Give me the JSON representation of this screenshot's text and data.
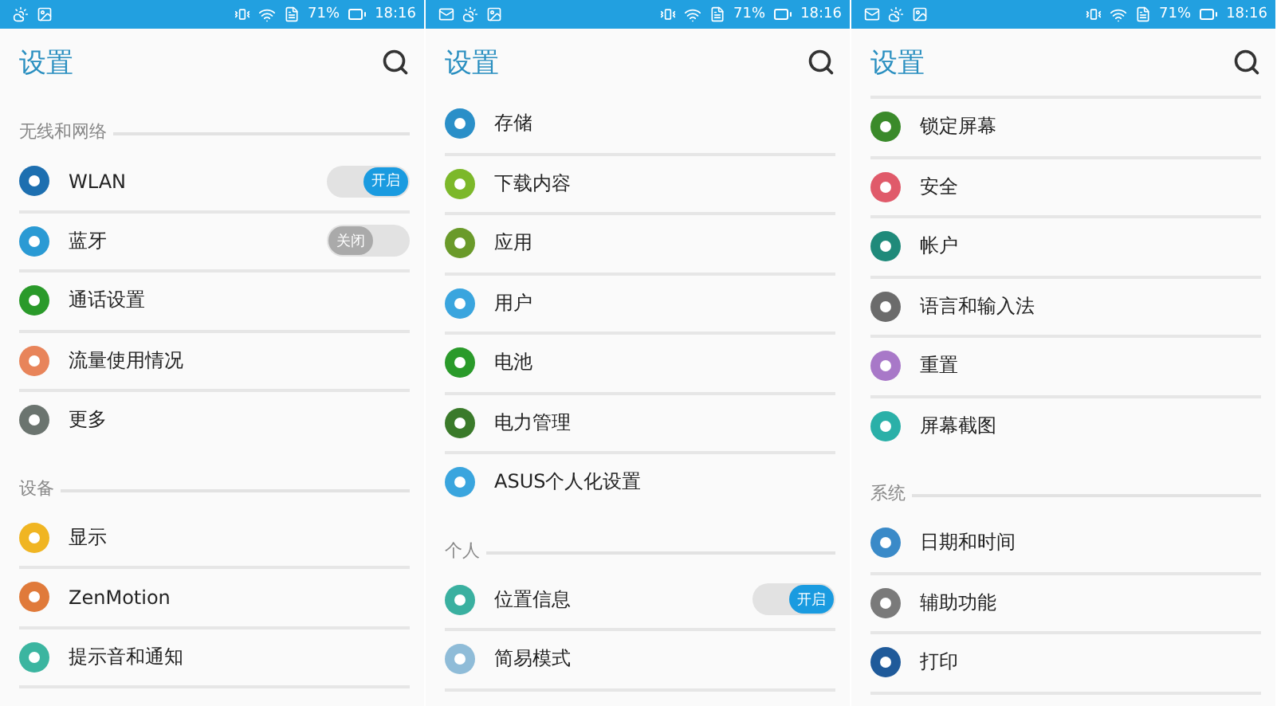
{
  "panels": [
    {
      "status_bar": {
        "notifications": [
          {
            "kind": "weather"
          },
          {
            "kind": "image"
          }
        ],
        "battery": "71%",
        "time": "18:16"
      },
      "title": "设置",
      "items": [
        {
          "kind": "section",
          "label": "无线和网络"
        },
        {
          "kind": "item",
          "label": "WLAN",
          "color": "#1d6fb0",
          "toggle": {
            "on": true,
            "label": "开启"
          }
        },
        {
          "kind": "item",
          "label": "蓝牙",
          "color": "#2a9ad4",
          "toggle": {
            "on": false,
            "label": "关闭"
          }
        },
        {
          "kind": "item",
          "label": "通话设置",
          "color": "#2a9a2a"
        },
        {
          "kind": "item",
          "label": "流量使用情况",
          "color": "#e8845a"
        },
        {
          "kind": "item",
          "label": "更多",
          "color": "#6b746f"
        },
        {
          "kind": "section",
          "label": "设备"
        },
        {
          "kind": "item",
          "label": "显示",
          "color": "#f0b522"
        },
        {
          "kind": "item",
          "label": "ZenMotion",
          "color": "#e07a3a"
        },
        {
          "kind": "item",
          "label": "提示音和通知",
          "color": "#3bb5a0"
        }
      ]
    },
    {
      "status_bar": {
        "notifications": [
          {
            "kind": "message"
          },
          {
            "kind": "weather"
          },
          {
            "kind": "image"
          }
        ],
        "battery": "71%",
        "time": "18:16"
      },
      "title": "设置",
      "items": [
        {
          "kind": "item",
          "label": "存储",
          "color": "#2a8fc8"
        },
        {
          "kind": "item",
          "label": "下载内容",
          "color": "#7cb82a"
        },
        {
          "kind": "item",
          "label": "应用",
          "color": "#6a9a2a"
        },
        {
          "kind": "item",
          "label": "用户",
          "color": "#3aa5de"
        },
        {
          "kind": "item",
          "label": "电池",
          "color": "#2a9a2a"
        },
        {
          "kind": "item",
          "label": "电力管理",
          "color": "#3a7a2a"
        },
        {
          "kind": "item",
          "label": "ASUS个人化设置",
          "color": "#3aa5de"
        },
        {
          "kind": "section",
          "label": "个人"
        },
        {
          "kind": "item",
          "label": "位置信息",
          "color": "#3ab0a0",
          "toggle": {
            "on": true,
            "label": "开启"
          }
        },
        {
          "kind": "item",
          "label": "简易模式",
          "color": "#8fbcd8"
        }
      ]
    },
    {
      "status_bar": {
        "notifications": [
          {
            "kind": "message"
          },
          {
            "kind": "weather"
          },
          {
            "kind": "image"
          }
        ],
        "battery": "71%",
        "time": "18:16"
      },
      "title": "设置",
      "items": [
        {
          "kind": "divider"
        },
        {
          "kind": "item",
          "label": "锁定屏幕",
          "color": "#3a8a2a"
        },
        {
          "kind": "item",
          "label": "安全",
          "color": "#e05a6a"
        },
        {
          "kind": "item",
          "label": "帐户",
          "color": "#1f8a7a"
        },
        {
          "kind": "item",
          "label": "语言和输入法",
          "color": "#6b6b6b"
        },
        {
          "kind": "item",
          "label": "重置",
          "color": "#a878c8"
        },
        {
          "kind": "item",
          "label": "屏幕截图",
          "color": "#2ab0a8"
        },
        {
          "kind": "section",
          "label": "系统"
        },
        {
          "kind": "item",
          "label": "日期和时间",
          "color": "#3a8ac8"
        },
        {
          "kind": "item",
          "label": "辅助功能",
          "color": "#7a7a7a"
        },
        {
          "kind": "item",
          "label": "打印",
          "color": "#1f5a9a"
        }
      ]
    }
  ]
}
